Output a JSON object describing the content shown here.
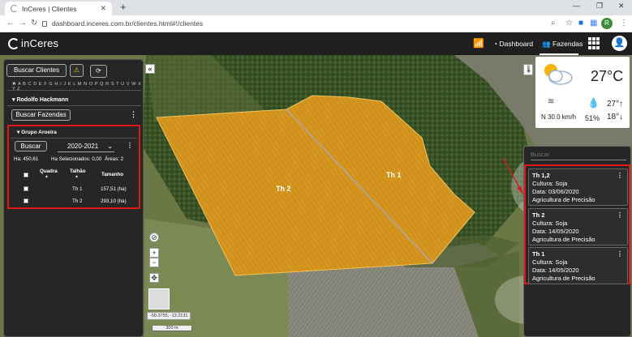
{
  "browser": {
    "tab_title": "InCeres | Clientes",
    "url": "dashboard.inceres.com.br/clientes.html#!/clientes",
    "profile_initial": "R"
  },
  "header": {
    "logo": "inCeres",
    "nav": {
      "dashboard": "Dashboard",
      "fazendas": "Fazendas"
    }
  },
  "sidebar": {
    "search_clients_label": "Buscar Clientes",
    "alphabet": "✖ A B C D E F G H I J K L M N O P Q R S T U V W X Y Z",
    "client_name": "Rodolfo Hackmann",
    "search_farms_label": "Buscar Fazendas",
    "group": {
      "name": "Grupo Aroeira",
      "search_label": "Buscar",
      "season": "2020-2021",
      "ha_label": "Ha: 450,61",
      "ha_selected": "Ha Selecionados: 0,00",
      "areas": "Áreas: 2",
      "columns": [
        "Quadra",
        "Talhão",
        "Tamanho"
      ],
      "rows": [
        {
          "talhao": "Th 1",
          "tamanho": "157,51 (ha)"
        },
        {
          "talhao": "Th 2",
          "tamanho": "293,10 (ha)"
        }
      ]
    }
  },
  "map": {
    "labels": [
      "Th 2",
      "Th 1"
    ],
    "coords": "-50.3755, -13.2131",
    "scale": "300 m"
  },
  "weather": {
    "temp": "27°C",
    "wind": "N 30.0 km/h",
    "humidity": "51%",
    "max": "27°",
    "min": "18°"
  },
  "right_panel": {
    "search_placeholder": "Buscar",
    "cards": [
      {
        "title": "Th 1,2",
        "culture": "Cultura: Soja",
        "date": "Data: 03/06/2020",
        "type": "Agricultura de Precisão"
      },
      {
        "title": "Th 2",
        "culture": "Cultura: Soja",
        "date": "Data: 14/05/2020",
        "type": "Agricultura de Precisão"
      },
      {
        "title": "Th 1",
        "culture": "Cultura: Soja",
        "date": "Data: 14/05/2020",
        "type": "Agricultura de Precisão"
      }
    ]
  },
  "colors": {
    "field": "#d4961f",
    "highlight": "#e01818",
    "wifi": "#5ec45e"
  }
}
